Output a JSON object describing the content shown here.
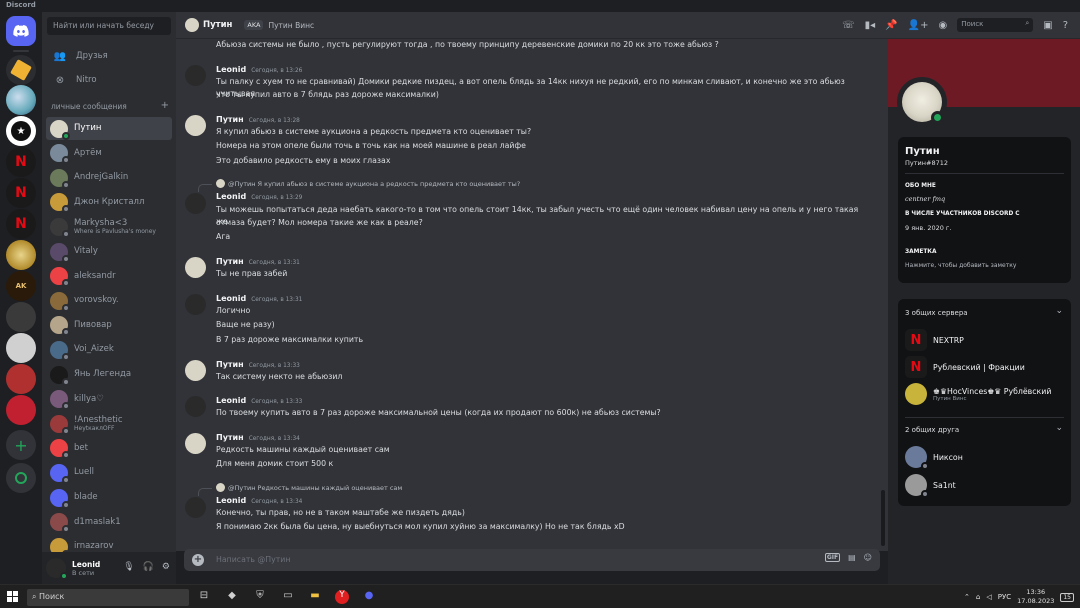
{
  "app": {
    "title": "Discord"
  },
  "search": {
    "placeholder": "Найти или начать беседу"
  },
  "nav": {
    "friends": "Друзья",
    "nitro": "Nitro"
  },
  "dm_header": {
    "label": "личные сообщения",
    "add": "+"
  },
  "dms": [
    {
      "name": "Путин",
      "sub": "",
      "status": "online",
      "color": "#d9d5c6",
      "active": true
    },
    {
      "name": "Артём",
      "sub": "",
      "status": "offline",
      "color": "#7a8a9a"
    },
    {
      "name": "AndrejGalkin",
      "sub": "",
      "status": "offline",
      "color": "#6a7a5a"
    },
    {
      "name": "Джон Кристалл",
      "sub": "",
      "status": "offline",
      "color": "#c89b3a"
    },
    {
      "name": "Markysha<3",
      "sub": "Where is Pavlusha's money",
      "status": "offline",
      "color": "#3a3a3a"
    },
    {
      "name": "Vitaly",
      "sub": "",
      "status": "offline",
      "color": "#5a4a6a"
    },
    {
      "name": "aleksandr",
      "sub": "",
      "status": "offline",
      "color": "#ed4245"
    },
    {
      "name": "vorovskoy.",
      "sub": "",
      "status": "offline",
      "color": "#8a6a3a"
    },
    {
      "name": "Пивовар",
      "sub": "",
      "status": "offline",
      "color": "#b5a58a"
    },
    {
      "name": "Voi_Aizek",
      "sub": "",
      "status": "offline",
      "color": "#4a6a8a"
    },
    {
      "name": "Янь Легенда",
      "sub": "",
      "status": "offline",
      "color": "#1a1a1a"
    },
    {
      "name": "killya♡",
      "sub": "",
      "status": "offline",
      "color": "#7a5a7a"
    },
    {
      "name": "!Anesthetic",
      "sub": "НеуtкаклOFF",
      "status": "offline",
      "color": "#9a3a3a"
    },
    {
      "name": "bet",
      "sub": "",
      "status": "offline",
      "color": "#ed4245"
    },
    {
      "name": "Luell",
      "sub": "",
      "status": "offline",
      "color": "#5865f2"
    },
    {
      "name": "blade",
      "sub": "",
      "status": "offline",
      "color": "#5865f2"
    },
    {
      "name": "d1maslak1",
      "sub": "",
      "status": "offline",
      "color": "#8a4a4a"
    },
    {
      "name": "irnazarov",
      "sub": "",
      "status": "offline",
      "color": "#c89b3a"
    }
  ],
  "user": {
    "name": "Leonid",
    "status": "В сети"
  },
  "header": {
    "name": "Путин",
    "aka": "AKA",
    "aka_name": "Путин Винс",
    "search_placeholder": "Поиск"
  },
  "messages": {
    "m0": {
      "line1": "Абьюза системы не было , пусть регулируют тогда , по твоему принципу деревенские домики по 20 кк это тоже абьюз ?"
    },
    "m1": {
      "author": "Leonid",
      "time": "Сегодня, в 13:26",
      "line1": "Ты палку с хуем то не сравнивай) Домики редкие пиздец, а вот опель блядь за 14кк нихуя не редкий, его по минкам сливают, и конечно же это абьюз учитывая",
      "line2": "что ты купил авто в 7 блядь раз дороже максималки)"
    },
    "m2": {
      "author": "Путин",
      "time": "Сегодня, в 13:28",
      "line1": "Я купил абьюз в системе аукциона а редкость предмета кто оценивает ты?",
      "line2": "Номера на этом опеле были точь в точь как на моей машине в реал лайфе",
      "line3": "Это добавило редкоcть ему в моих глазах"
    },
    "m3": {
      "reply": "@Путин Я купил абьюз в системе аукциона а редкость предмета кто оценивает ты?",
      "author": "Leonid",
      "time": "Сегодня, в 13:29",
      "line1": "Ты можешь попытаться деда наебать какого-то  в том что опель стоит 14кк, ты забыл учесть что ещё один человек набивал цену на опель и у него такая же",
      "line2": "отмаза будет? Мол номера такие же как в реале?",
      "line3": "Ага"
    },
    "m4": {
      "author": "Путин",
      "time": "Сегодня, в 13:31",
      "line1": "Ты не прав забей"
    },
    "m5": {
      "author": "Leonid",
      "time": "Сегодня, в 13:31",
      "line1": "Логично",
      "line2": "Ваще не разу)",
      "line3": "В 7 раз дороже максималки купить"
    },
    "m6": {
      "author": "Путин",
      "time": "Сегодня, в 13:33",
      "line1": "Так систему некто не абьюзил"
    },
    "m7": {
      "author": "Leonid",
      "time": "Сегодня, в 13:33",
      "line1": "По твоему купить авто в 7 раз дороже максимальной цены (когда их продают по 600к) не абьюз системы?"
    },
    "m8": {
      "author": "Путин",
      "time": "Сегодня, в 13:34",
      "line1": "Редкость машины каждый оценивает сам",
      "line2": "Для меня домик стоит 500 к"
    },
    "m9": {
      "reply": "@Путин Редкость машины каждый оценивает сам",
      "author": "Leonid",
      "time": "Сегодня, в 13:34",
      "line1": "Конечно, ты прав, но не в таком маштабе же пиздеть дядь)",
      "line2": "Я понимаю 2кк была бы цена, ну выебнуться мол купил хуйню за максималку) Но не так блядь xD"
    }
  },
  "input": {
    "placeholder": "Написать @Путин",
    "gif": "GIF"
  },
  "profile": {
    "name": "Путин",
    "tag": "Путин#8712",
    "about_title": "ОБО МНЕ",
    "about": "centner fmq",
    "member_title": "В ЧИСЛЕ УЧАСТНИКОВ DISCORD С",
    "member_since": "9 янв. 2020 г.",
    "note_title": "ЗАМЕТКА",
    "note": "Нажмите, чтобы добавить заметку",
    "servers_title": "3 общих сервера",
    "servers": [
      {
        "name": "NEXTRP",
        "sub": "",
        "color": "#1a1a1a"
      },
      {
        "name": "Рублевский | Фракции",
        "sub": "",
        "color": "#1a1a1a"
      },
      {
        "name": "♚♛HocVinces♚♛ Рублёвский",
        "sub": "Путин Винс",
        "color": "#c8b43a"
      }
    ],
    "friends_title": "2 общих друга",
    "friends": [
      {
        "name": "Никсон",
        "color": "#6a7a9a"
      },
      {
        "name": "Sa1nt",
        "color": "#9a9a9a"
      }
    ]
  },
  "taskbar": {
    "search": "Поиск",
    "lang": "РУС",
    "time": "13:36",
    "date": "17.08.2023",
    "notif": "15"
  },
  "colors": {
    "accent": "#5865f2",
    "online": "#23a55a",
    "banner": "#6e1a25"
  }
}
